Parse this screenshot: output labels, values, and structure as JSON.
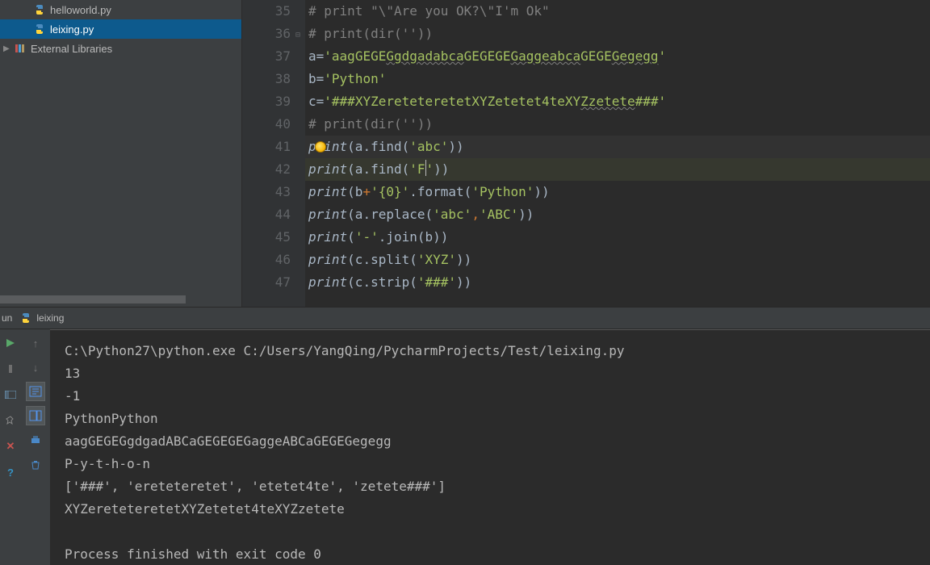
{
  "tree": {
    "items": [
      {
        "name": "helloworld.py",
        "selected": false,
        "type": "py"
      },
      {
        "name": "leixing.py",
        "selected": true,
        "type": "py"
      }
    ],
    "ext_lib_label": "External Libraries"
  },
  "editor": {
    "lines": [
      {
        "n": 35,
        "kind": "comment",
        "text": "# print \"\\\"Are you OK?\\\"I'm Ok\""
      },
      {
        "n": 36,
        "kind": "comment",
        "text": "# print(dir(''))"
      },
      {
        "n": 37,
        "kind": "assign_a",
        "var": "a",
        "str_parts": [
          "'aagGEGE",
          "Ggdgadabca",
          "GEGEGE",
          "Gaggeabca",
          "GEGE",
          "Gegegg",
          "'"
        ]
      },
      {
        "n": 38,
        "kind": "assign",
        "var": "b",
        "str": "'Python'"
      },
      {
        "n": 39,
        "kind": "assign_c",
        "var": "c",
        "str_parts": [
          "'###XYZereteteretetXYZetetet4teXY",
          "Zzetete",
          "###'"
        ]
      },
      {
        "n": 40,
        "kind": "comment",
        "text": "# print(dir(''))"
      },
      {
        "n": 41,
        "kind": "p_find",
        "arg": "'abc'",
        "bulb": true,
        "hl": true
      },
      {
        "n": 42,
        "kind": "p_findcur",
        "arg_pre": "'F",
        "arg_post": "'",
        "hl2": true
      },
      {
        "n": 43,
        "kind": "p_format",
        "argfmt": "'{0}'",
        "argval": "'Python'"
      },
      {
        "n": 44,
        "kind": "p_replace",
        "a1": "'abc'",
        "a2": "'ABC'"
      },
      {
        "n": 45,
        "kind": "p_join",
        "sep": "'-'"
      },
      {
        "n": 46,
        "kind": "p_split",
        "arg": "'XYZ'"
      },
      {
        "n": 47,
        "kind": "p_strip",
        "arg": "'###'"
      }
    ]
  },
  "runbar": {
    "prefix": "un",
    "title": "leixing"
  },
  "console": {
    "lines": [
      "C:\\Python27\\python.exe C:/Users/YangQing/PycharmProjects/Test/leixing.py",
      "13",
      "-1",
      "PythonPython",
      "aagGEGEGgdgadABCaGEGEGEGaggeABCaGEGEGegegg",
      "P-y-t-h-o-n",
      "['###', 'ereteteretet', 'etetet4te', 'zetete###']",
      "XYZereteteretetXYZetetet4teXYZzetete",
      "",
      "Process finished with exit code 0"
    ]
  }
}
